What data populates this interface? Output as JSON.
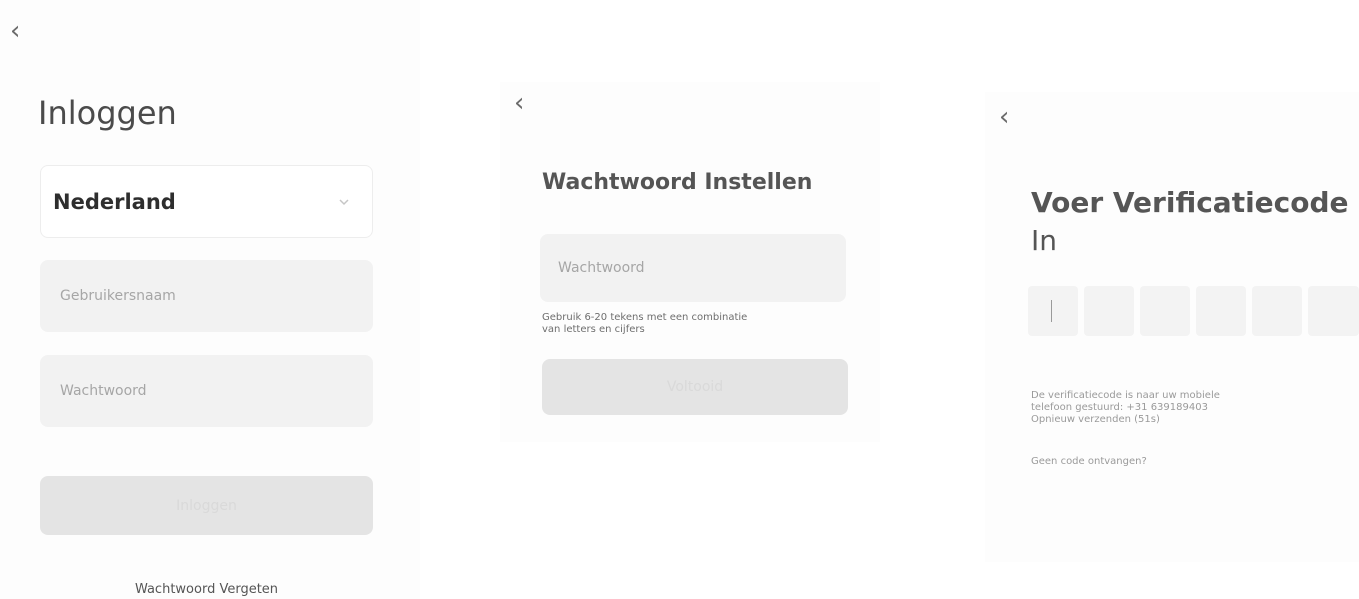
{
  "login": {
    "title": "Inloggen",
    "country": "Nederland",
    "username_placeholder": "Gebruikersnaam",
    "password_placeholder": "Wachtwoord",
    "submit_label": "Inloggen",
    "forgot_label": "Wachtwoord Vergeten"
  },
  "set_password": {
    "title": "Wachtwoord Instellen",
    "password_placeholder": "Wachtwoord",
    "hint_line1": "Gebruik 6-20 tekens met een combinatie",
    "hint_line2": "van letters en cijfers",
    "submit_label": "Voltooid"
  },
  "verify": {
    "title_line1": "Voer Verificatiecode",
    "title_line2": "In",
    "info_line1": "De verificatiecode is naar uw mobiele",
    "info_line2": "telefoon gestuurd: +31 639189403",
    "resend": "Opnieuw verzenden (51s)",
    "no_code": "Geen code ontvangen?",
    "code_digits": [
      "",
      "",
      "",
      "",
      "",
      ""
    ]
  },
  "icons": {
    "back": "chevron-left-icon",
    "dropdown": "chevron-down-icon"
  },
  "colors": {
    "field_bg": "#f2f2f2",
    "button_disabled_bg": "#e4e4e4",
    "text_dark": "#4b4b4b"
  }
}
